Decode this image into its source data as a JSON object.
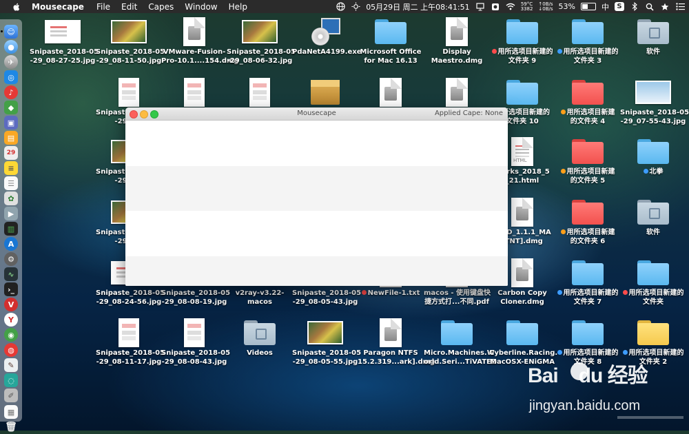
{
  "menubar": {
    "app_name": "Mousecape",
    "menus": [
      "File",
      "Edit",
      "Capes",
      "Window",
      "Help"
    ],
    "cpu_temp": "59°C",
    "fan_rpm": "3382",
    "net_up": "0B/s",
    "net_down": "0B/s",
    "battery_percent": "53%",
    "battery_level": 0.53,
    "datetime": "05月29日 周二 上午08:41:51",
    "input_method": "中",
    "input_method_alt": "S"
  },
  "window": {
    "title": "Mousecape",
    "applied_cape": "Applied Cape: None"
  },
  "desktop": {
    "items": [
      {
        "icon": "screenshot-plain",
        "label": "Snipaste_2018-05\n-29_08-27-25.jpg"
      },
      {
        "icon": "screenshot-colorful",
        "label": "Snipaste_2018-05\n-29_08-11-50.jpg"
      },
      {
        "icon": "disk-image",
        "label": "VMware-Fusion-\nPro-10.1....154.dmg"
      },
      {
        "icon": "screenshot-colorful",
        "label": "Snipaste_2018-05\n-29_08-06-32.jpg"
      },
      {
        "icon": "installer",
        "label": "PdaNetA4199.exe"
      },
      {
        "icon": "folder-blue",
        "label": "Microsoft Office\nfor Mac 16.13"
      },
      {
        "icon": "disk-image",
        "label": "Display\nMaestro.dmg"
      },
      {
        "icon": "folder-blue",
        "tag": "red",
        "label": "用所选项目新建的\n文件夹 9"
      },
      {
        "icon": "folder-blue",
        "tag": "blue",
        "label": "用所选项目新建的\n文件夹 3"
      },
      {
        "icon": "folder-gray",
        "label": "软件"
      },
      {
        "icon": "screenshot-portrait",
        "label": "Snipaste_2018-05\n-29_08-"
      },
      {
        "icon": "folder-blue",
        "label": "用所选项目新建的\n文件夹 10"
      },
      {
        "icon": "folder-red",
        "tag": "orange",
        "label": "用所选项目新建\n的文件夹 4"
      },
      {
        "icon": "screenshot-blueish",
        "label": "Snipaste_2018-05\n-29_07-55-43.jpg"
      },
      {
        "icon": "screenshot-colorful",
        "label": "Snipaste_2018-05\n-29_08-"
      },
      {
        "icon": "html-doc",
        "label": "marks_2018_5\n_21.html"
      },
      {
        "icon": "folder-red",
        "tag": "orange",
        "label": "用所选项目新建\n的文件夹 5"
      },
      {
        "icon": "folder-blue",
        "tag": "blue",
        "label": "北拳"
      },
      {
        "icon": "screenshot-colorful",
        "label": "Snipaste_2018-05\n-29_08-"
      },
      {
        "icon": "disk-image",
        "label": "n_3D_1.1.1_MA\n[TNT].dmg"
      },
      {
        "icon": "folder-red",
        "tag": "orange",
        "label": "用所选项目新建\n的文件夹 6"
      },
      {
        "icon": "folder-gray",
        "label": "软件"
      },
      {
        "icon": "screenshot-plain",
        "label": "Snipaste_2018-05\n-29_08-24-56.jpg"
      },
      {
        "icon": "screenshot-plain",
        "label": "Snipaste_2018-05\n-29_08-08-19.jpg"
      },
      {
        "icon": "folder-blue",
        "label": "v2ray-v3.22-\nmacos"
      },
      {
        "icon": "screenshot-plain",
        "label": "Snipaste_2018-05\n-29_08-05-43.jpg"
      },
      {
        "icon": "text-doc",
        "tag": "red",
        "label": "NewFile-1.txt"
      },
      {
        "icon": "pdf-doc",
        "label": "macos - 使用键盘快\n捷方式打...不同.pdf"
      },
      {
        "icon": "disk-image",
        "label": "Carbon Copy\nCloner.dmg"
      },
      {
        "icon": "folder-blue",
        "tag": "blue",
        "label": "用所选项目新建的\n文件夹 7"
      },
      {
        "icon": "folder-blue",
        "tag": "red",
        "label": "用所选项目新建的\n文件夹"
      },
      {
        "icon": "screenshot-portrait",
        "label": "Snipaste_2018-05\n-29_08-11-17.jpg"
      },
      {
        "icon": "screenshot-portrait",
        "label": "Snipaste_2018-05\n-29_08-08-43.jpg"
      },
      {
        "icon": "folder-gray",
        "label": "Videos"
      },
      {
        "icon": "screenshot-colorful",
        "label": "Snipaste_2018-05\n-29_08-05-55.jpg"
      },
      {
        "icon": "disk-image",
        "label": "Paragon NTFS\n15.2.319...ark].dmg"
      },
      {
        "icon": "folder-blue",
        "label": "Micro.Machines.W\norld.Seri...TiVATED"
      },
      {
        "icon": "folder-blue",
        "label": "Cyberline.Racing.\nMacOSX-ENiGMA"
      },
      {
        "icon": "folder-blue",
        "tag": "blue",
        "label": "用所选项目新建的\n文件夹 8"
      },
      {
        "icon": "folder-yellow",
        "tag": "blue",
        "label": "用所选项目新建的\n文件夹 2"
      }
    ]
  },
  "watermark": {
    "logo_text_1": "Bai",
    "logo_text_2": "du",
    "logo_text_3": "经验",
    "url": "jingyan.baidu.com"
  }
}
